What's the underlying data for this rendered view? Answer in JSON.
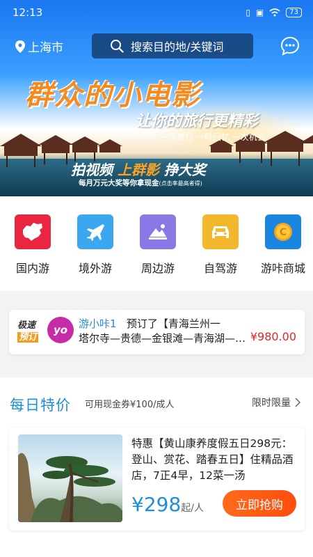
{
  "status_bar": {
    "time": "12:13",
    "battery": "73"
  },
  "header": {
    "location": "上海市",
    "search_placeholder": "搜索目的地/关键词"
  },
  "banner": {
    "headline": "群众的小电影",
    "tagline": "让你的旅行更精彩",
    "subline": "一次旅行 一段回忆 一次机会",
    "cta_prefix": "拍视频",
    "cta_highlight": "上群影",
    "cta_suffix": "挣大奖",
    "prize_text": "每月万元大奖等你拿现金",
    "prize_note": "(点击率最高者得)"
  },
  "categories": [
    {
      "label": "国内游",
      "icon": "china-map-icon",
      "color": "#e8263f"
    },
    {
      "label": "境外游",
      "icon": "airplane-icon",
      "color": "#3aa7ee"
    },
    {
      "label": "周边游",
      "icon": "mountain-image-icon",
      "color": "#8a78e6"
    },
    {
      "label": "自驾游",
      "icon": "car-icon",
      "color": "#f2b72b"
    },
    {
      "label": "游咔商城",
      "icon": "coin-icon",
      "color": "#1b86e0"
    }
  ],
  "ticker": {
    "badge_line1": "极速",
    "badge_line2": "预订",
    "avatar_text": "yo",
    "user": "游小咔1",
    "action": "预订了【青海兰州一",
    "detail": "塔尔寺—贵德—金银滩—青海湖—茶卡盐湖",
    "price": "¥980.00"
  },
  "deals": {
    "title": "每日特价",
    "subtitle": "可用现金券¥100/成人",
    "more": "限时限量",
    "item": {
      "description": "特惠【黄山康养度假五日298元：登山、赏花、踏春五日】住精品酒店，7正4早，12菜一汤",
      "price": "¥298",
      "unit": "起/人",
      "button": "立即抢购"
    }
  }
}
